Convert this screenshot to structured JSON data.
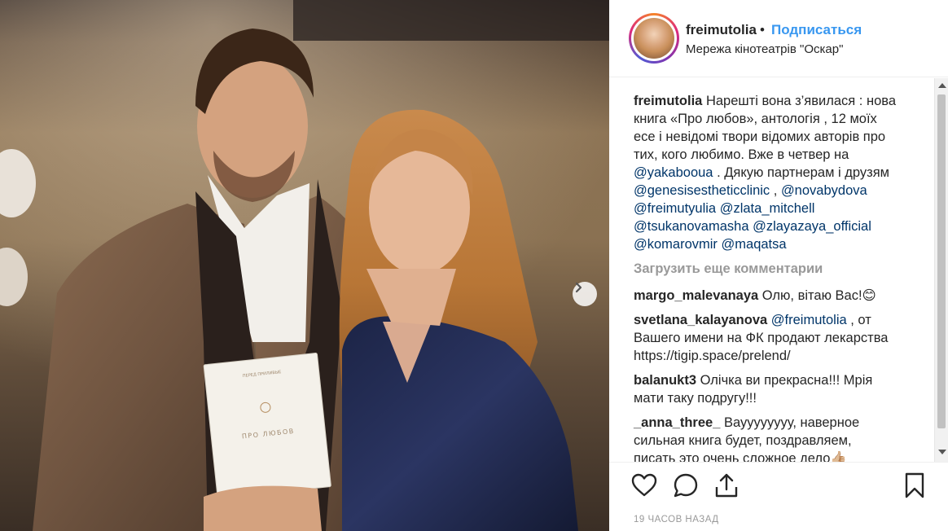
{
  "post": {
    "username": "freimutolia",
    "separator": "•",
    "follow_label": "Подписаться",
    "location": "Мережа кінотеатрів \"Оскар\"",
    "book_author": "ПЕРЕД ПРИЛИВЫЕ",
    "book_title": "ПРО ЛЮБОВ"
  },
  "caption": {
    "username": "freimutolia",
    "lines": [
      "Нарешті вона з’явилася : нова",
      "книга «Про любов», антологія , 12 моїх",
      "есе і невідомі твори відомих авторів про",
      "тих, кого любимо. Вже в четвер на"
    ],
    "line5_link": "@yakabooua",
    "line5_text": " . Дякую партнерам і друзям",
    "line6_link1": "@genesisestheticclinic",
    "line6_sep": " , ",
    "line6_link2": "@novabydova",
    "line7_link1": "@freimutyulia",
    "line7_link2": "@zlata_mitchell",
    "line8_link1": "@tsukanovamasha",
    "line8_link2": "@zlayazaya_official",
    "line9_link1": "@komarovmir",
    "line9_link2": "@maqatsa"
  },
  "load_more": "Загрузить еще комментарии",
  "comments": [
    {
      "username": "margo_malevanaya",
      "text": "Олю, вітаю Вас!😊"
    },
    {
      "username": "svetlana_kalayanova",
      "mention": "@freimutolia",
      "text": " , от",
      "line2": "Вашего имени на ФК продают лекарства",
      "line3": "https://tigip.space/prelend/"
    },
    {
      "username": "balanukt3",
      "text": "Олічка ви прекрасна!!! Мрія",
      "line2": "мати таку подругу!!!"
    },
    {
      "username": "_anna_three_",
      "text": "Вауууууууу, наверное",
      "line2": "сильная книга будет, поздравляем,",
      "line3": "писать это очень сложное дело👍🏼"
    }
  ],
  "timestamp": "19 ЧАСОВ НАЗАД",
  "icons": {
    "like": "heart-icon",
    "comment": "comment-icon",
    "share": "share-icon",
    "save": "bookmark-icon",
    "next": "chevron-right-icon"
  },
  "colors": {
    "link": "#003569",
    "follow": "#3897f0",
    "muted": "#999999"
  }
}
